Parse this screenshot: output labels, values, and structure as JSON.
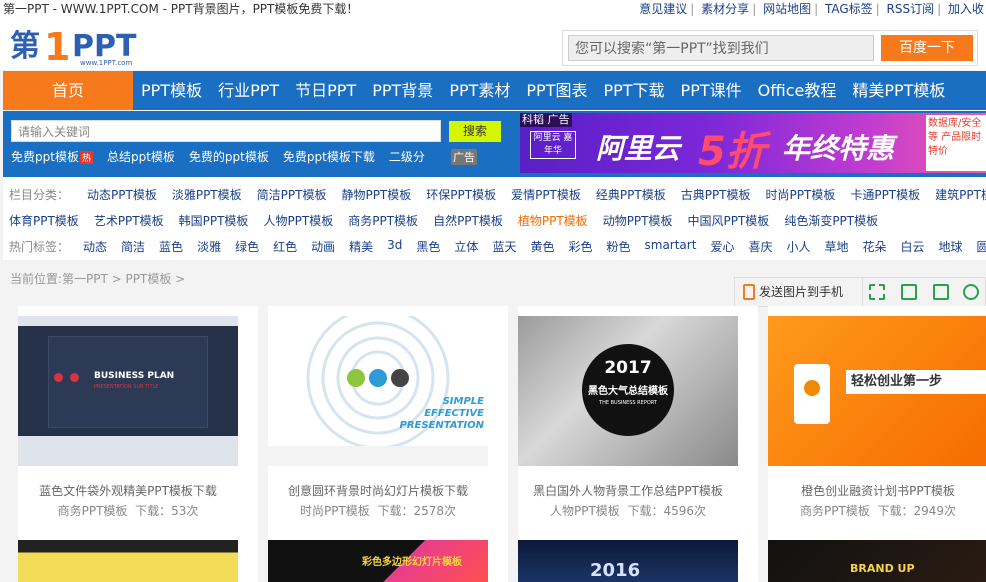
{
  "topbar": {
    "site_title": "第一PPT - WWW.1PPT.COM - PPT背景图片，PPT模板免费下载！",
    "links": [
      "意见建议",
      "素材分享",
      "网站地图",
      "TAG标签",
      "RSS订阅",
      "加入收"
    ]
  },
  "header": {
    "logo_text": "第1PPT",
    "logo_sub": "www.1PPT.com",
    "search_placeholder": "您可以搜索“第一PPT”找到我们",
    "search_button": "百度一下"
  },
  "nav": {
    "home": "首页",
    "items": [
      "PPT模板",
      "行业PPT",
      "节日PPT",
      "PPT背景",
      "PPT素材",
      "PPT图表",
      "PPT下载",
      "PPT课件",
      "Office教程",
      "精美PPT模板"
    ]
  },
  "subsearch": {
    "placeholder": "请输入关键词",
    "button": "搜索",
    "quicklinks": [
      "免费ppt模板",
      "总结ppt模板",
      "免费的ppt模板",
      "免费ppt模板下载",
      "二级分"
    ],
    "hot_badge": "热",
    "ad_label": "广告"
  },
  "banner": {
    "ad_tag": "科韬 广告",
    "small_logo": "阿里云 嘉年华",
    "brand": "阿里云",
    "sale": "5折",
    "sale2": "年终特惠",
    "side_text": "数据库/安全等 产品限时特价"
  },
  "categories": {
    "row1_label": "栏目分类：",
    "row1": [
      "动态PPT模板",
      "淡雅PPT模板",
      "简洁PPT模板",
      "静物PPT模板",
      "环保PPT模板",
      "爱情PPT模板",
      "经典PPT模板",
      "古典PPT模板",
      "时尚PPT模板",
      "卡通PPT模板",
      "建筑PPT模板"
    ],
    "row2": [
      "体育PPT模板",
      "艺术PPT模板",
      "韩国PPT模板",
      "人物PPT模板",
      "商务PPT模板",
      "自然PPT模板",
      "植物PPT模板",
      "动物PPT模板",
      "中国风PPT模板",
      "纯色渐变PPT模板"
    ],
    "row3_label": "热门标签：",
    "row3": [
      "动态",
      "简洁",
      "蓝色",
      "淡雅",
      "绿色",
      "红色",
      "动画",
      "精美",
      "3d",
      "黑色",
      "立体",
      "蓝天",
      "黄色",
      "彩色",
      "粉色",
      "smartart",
      "爱心",
      "喜庆",
      "小人",
      "草地",
      "花朵",
      "白云",
      "地球",
      "圆环"
    ]
  },
  "breadcrumb": "当前位置:第一PPT > PPT模板 >",
  "toolbar": {
    "send_phone": "发送图片到手机"
  },
  "cards": [
    {
      "title": "蓝色文件袋外观精美PPT模板下载",
      "category": "商务PPT模板",
      "downloads": "下载：53次",
      "thumb_text": "BUSINESS PLAN",
      "thumb_sub": "PRESENTATION SUB TITLE"
    },
    {
      "title": "创意圆环背景时尚幻灯片模板下载",
      "category": "时尚PPT模板",
      "downloads": "下载：2578次",
      "thumb_text": "SIMPLE EFFECTIVE PRESENTATION"
    },
    {
      "title": "黑白国外人物背景工作总结PPT模板",
      "category": "人物PPT模板",
      "downloads": "下载：4596次",
      "thumb_text": "2017",
      "thumb_sub": "黑色大气总结模板",
      "thumb_sub2": "THE BUSINESS REPORT"
    },
    {
      "title": "橙色创业融资计划书PPT模板",
      "category": "商务PPT模板",
      "downloads": "下载：2949次",
      "thumb_text": "轻松创业第一步"
    }
  ],
  "row2_texts": [
    "彩色多边形幻灯片模板",
    "2016",
    "BRAND UP"
  ],
  "colors": {
    "nav_blue": "#1b6fc2",
    "orange": "#f67a1c",
    "link": "#1a3f8a",
    "active": "#f56a00"
  }
}
